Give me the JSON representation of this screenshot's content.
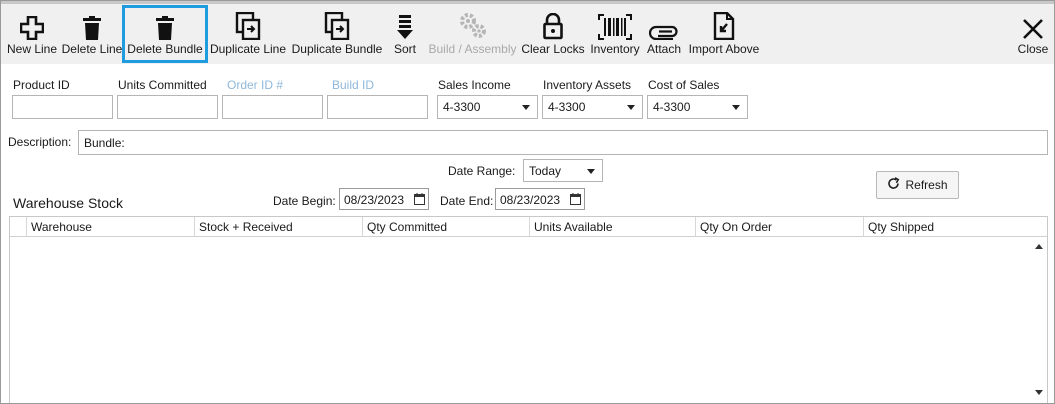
{
  "toolbar": {
    "new_line": "New Line",
    "delete_line": "Delete Line",
    "delete_bundle": "Delete Bundle",
    "duplicate_line": "Duplicate Line",
    "duplicate_bundle": "Duplicate Bundle",
    "sort": "Sort",
    "build_assembly": "Build / Assembly",
    "clear_locks": "Clear Locks",
    "inventory": "Inventory",
    "attach": "Attach",
    "import_above": "Import Above",
    "close": "Close",
    "selected_button": "Delete Bundle",
    "selection_color": "#1f9be0"
  },
  "form": {
    "product_id_label": "Product ID",
    "product_id_value": "",
    "units_committed_label": "Units Committed",
    "units_committed_value": "",
    "order_id_label": "Order ID #",
    "order_id_value": "",
    "build_id_label": "Build ID",
    "build_id_value": "",
    "sales_income_label": "Sales Income",
    "sales_income_value": "4-3300",
    "inventory_assets_label": "Inventory Assets",
    "inventory_assets_value": "4-3300",
    "cost_of_sales_label": "Cost of Sales",
    "cost_of_sales_value": "4-3300",
    "description_label": "Description:",
    "description_value": "Bundle:",
    "date_range_label": "Date Range:",
    "date_range_value": "Today",
    "date_begin_label": "Date Begin:",
    "date_begin_value": "08/23/2023",
    "date_end_label": "Date End:",
    "date_end_value": "08/23/2023",
    "refresh_label": "Refresh"
  },
  "warehouse": {
    "title": "Warehouse Stock",
    "columns": [
      "Warehouse",
      "Stock + Received",
      "Qty Committed",
      "Units Available",
      "Qty On Order",
      "Qty Shipped"
    ],
    "rows": []
  }
}
